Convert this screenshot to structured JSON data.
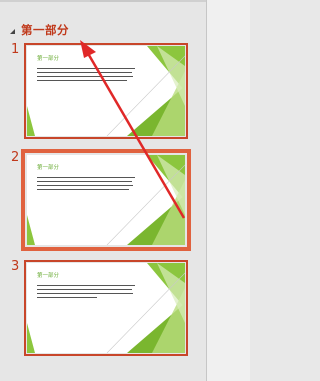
{
  "section": {
    "title": "第一部分"
  },
  "slides": [
    {
      "number": "1",
      "title": "第一部分",
      "selected": false
    },
    {
      "number": "2",
      "title": "第一部分",
      "selected": true
    },
    {
      "number": "3",
      "title": "第一部分",
      "selected": false
    }
  ],
  "colors": {
    "accent": "#c0391b",
    "slide_title": "#6cad38",
    "selection": "#e0623f",
    "arrow": "#e02828"
  }
}
